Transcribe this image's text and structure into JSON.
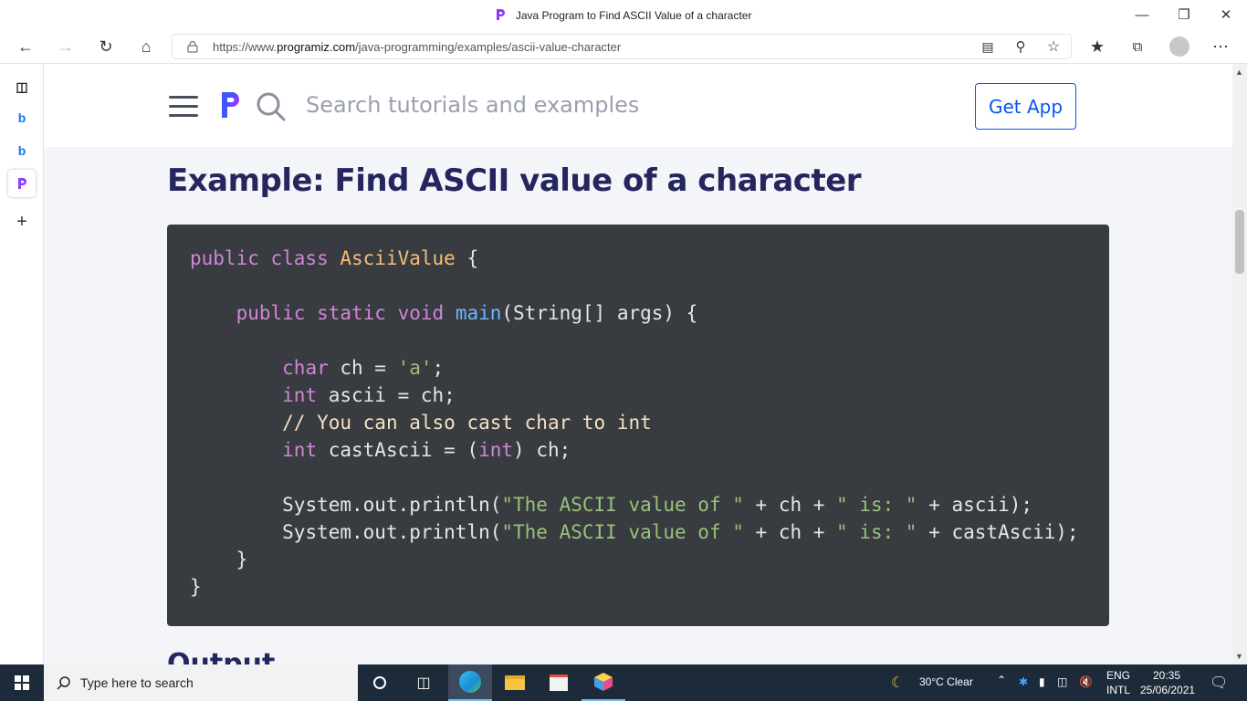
{
  "window": {
    "title": "Java Program to Find ASCII Value of a character"
  },
  "browser": {
    "url_prefix": "https://www.",
    "url_domain": "programiz.com",
    "url_path": "/java-programming/examples/ascii-value-character"
  },
  "site": {
    "search_placeholder": "Search tutorials and examples",
    "get_app": "Get App",
    "heading": "Example: Find ASCII value of a character",
    "next_heading_partial": "Output"
  },
  "code": {
    "l1": {
      "kw": "public class",
      "type": "AsciiValue",
      "rest": " {"
    },
    "l3": {
      "kw": "public static void",
      "fn": "main",
      "rest": "(String[] args) {"
    },
    "l5": {
      "kw": "char",
      "mid": " ch = ",
      "str": "'a'",
      "rest": ";"
    },
    "l6": {
      "kw": "int",
      "rest": " ascii = ch;"
    },
    "l7": {
      "comment": "// You can also cast char to int"
    },
    "l8": {
      "kw": "int",
      "mid": " castAscii = (",
      "kw2": "int",
      "rest": ") ch;"
    },
    "l10": {
      "a": "System.out.println(",
      "s1": "\"The ASCII value of \"",
      "b": " + ch + ",
      "s2": "\" is: \"",
      "c": " + ascii);"
    },
    "l11": {
      "a": "System.out.println(",
      "s1": "\"The ASCII value of \"",
      "b": " + ch + ",
      "s2": "\" is: \"",
      "c": " + castAscii);"
    },
    "l12": "}",
    "l13": "}"
  },
  "taskbar": {
    "search_placeholder": "Type here to search",
    "weather": "30°C  Clear",
    "lang1": "ENG",
    "lang2": "INTL",
    "time": "20:35",
    "date": "25/06/2021"
  },
  "colors": {
    "brand": "#0556f3",
    "heading": "#25265e",
    "code_bg": "#383b40"
  }
}
